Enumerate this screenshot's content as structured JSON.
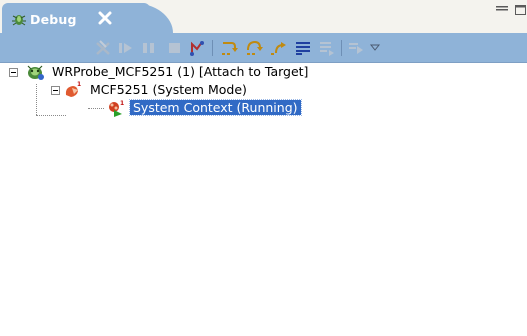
{
  "view": {
    "tab_title": "Debug",
    "tab_icon": "debug-bug-icon",
    "close_icon": "close-x-icon"
  },
  "window_controls": [
    "minimize-icon",
    "maximize-icon"
  ],
  "toolbar": {
    "buttons": [
      {
        "name": "remove-all-terminated-icon",
        "enabled": false
      },
      {
        "name": "resume-icon",
        "enabled": false
      },
      {
        "name": "suspend-icon",
        "enabled": false
      },
      {
        "name": "terminate-icon",
        "enabled": false
      },
      {
        "name": "disconnect-icon",
        "enabled": true
      },
      {
        "name": "step-into-icon",
        "enabled": true
      },
      {
        "name": "step-over-icon",
        "enabled": true
      },
      {
        "name": "step-return-icon",
        "enabled": true
      },
      {
        "name": "instruction-stepping-icon",
        "enabled": true
      },
      {
        "name": "drop-to-frame-icon",
        "enabled": false
      },
      {
        "name": "use-step-filters-icon",
        "enabled": false
      },
      {
        "name": "view-menu-icon",
        "enabled": true
      }
    ]
  },
  "tree": [
    {
      "label": "WRProbe_MCF5251 (1) [Attach to Target]",
      "icon": "target-connection-icon",
      "expanded": true
    },
    {
      "label": "MCF5251 (System Mode)",
      "icon": "cpu-system-mode-icon",
      "expanded": true
    },
    {
      "label": "System Context (Running)",
      "icon": "running-context-icon",
      "selected": true
    }
  ],
  "colors": {
    "tab_bg": "#8fb3d8",
    "selection": "#316ac5",
    "background": "#ffffff"
  }
}
